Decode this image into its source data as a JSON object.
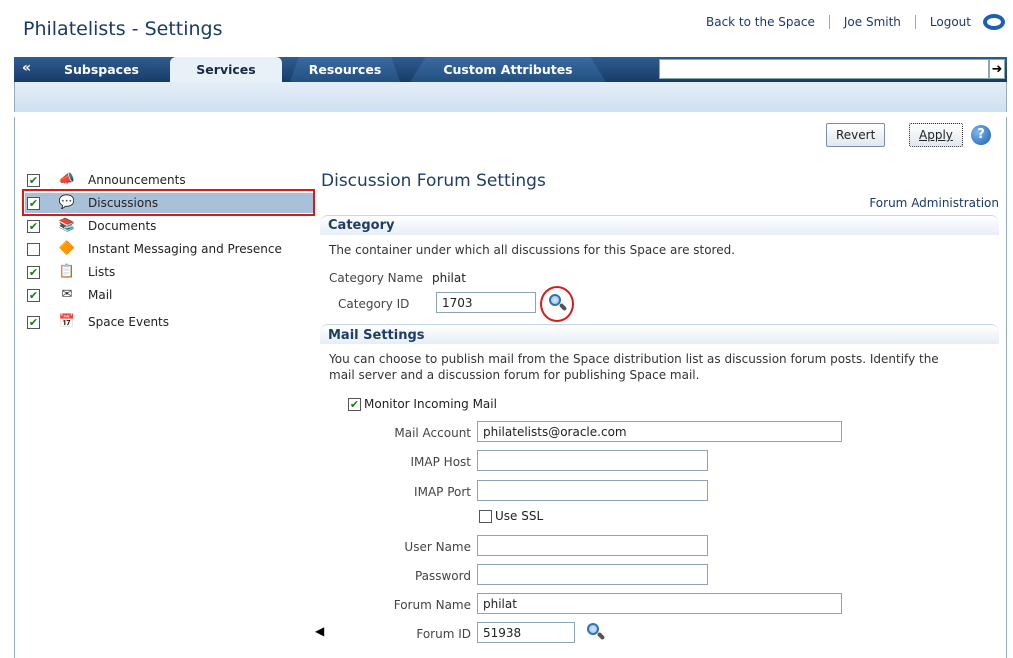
{
  "header": {
    "title": "Philatelists - Settings",
    "links": [
      "Back to the Space",
      "Joe Smith",
      "Logout"
    ]
  },
  "tabs": {
    "collapse": "«",
    "items": [
      "Subspaces",
      "Services",
      "Resources",
      "Custom Attributes"
    ],
    "active": "Services",
    "search_go": "➜"
  },
  "toolbar": {
    "revert": "Revert",
    "apply": "Apply",
    "help": "?"
  },
  "services": [
    {
      "label": "Announcements",
      "checked": true,
      "icon": "megaphone-icon",
      "glyph": "📣"
    },
    {
      "label": "Discussions",
      "checked": true,
      "icon": "speech-bubble-icon",
      "glyph": "💬",
      "selected": true
    },
    {
      "label": "Documents",
      "checked": true,
      "icon": "documents-icon",
      "glyph": "📚"
    },
    {
      "label": "Instant Messaging and Presence",
      "checked": false,
      "icon": "presence-icon",
      "glyph": "🔶"
    },
    {
      "label": "Lists",
      "checked": true,
      "icon": "list-icon",
      "glyph": "📋"
    },
    {
      "label": "Mail",
      "checked": true,
      "icon": "mail-icon",
      "glyph": "✉"
    },
    {
      "label": "Space Events",
      "checked": true,
      "icon": "calendar-icon",
      "glyph": "📅"
    }
  ],
  "main": {
    "heading": "Discussion Forum Settings",
    "forum_admin": "Forum Administration",
    "category": {
      "title": "Category",
      "description": "The container under which all discussions for this Space are stored.",
      "name_label": "Category Name",
      "name_value": "philat",
      "id_label": "Category ID",
      "id_value": "1703"
    },
    "mail": {
      "title": "Mail Settings",
      "description_line1": "You can choose to publish mail from the Space distribution list as discussion forum posts. Identify the",
      "description_line2": "mail server and a discussion forum for publishing Space mail.",
      "monitor_label": "Monitor Incoming Mail",
      "monitor_checked": true,
      "account_label": "Mail Account",
      "account_value": "philatelists@oracle.com",
      "imap_host_label": "IMAP Host",
      "imap_host_value": "",
      "imap_port_label": "IMAP Port",
      "imap_port_value": "",
      "ssl_label": "Use SSL",
      "ssl_checked": false,
      "user_label": "User Name",
      "user_value": "",
      "password_label": "Password",
      "password_value": "",
      "forum_name_label": "Forum Name",
      "forum_name_value": "philat",
      "forum_id_label": "Forum ID",
      "forum_id_value": "51938"
    }
  },
  "colors": {
    "highlight": "#d71a1a",
    "tabbar": "#1f4a7c",
    "heading": "#1f3d66"
  }
}
